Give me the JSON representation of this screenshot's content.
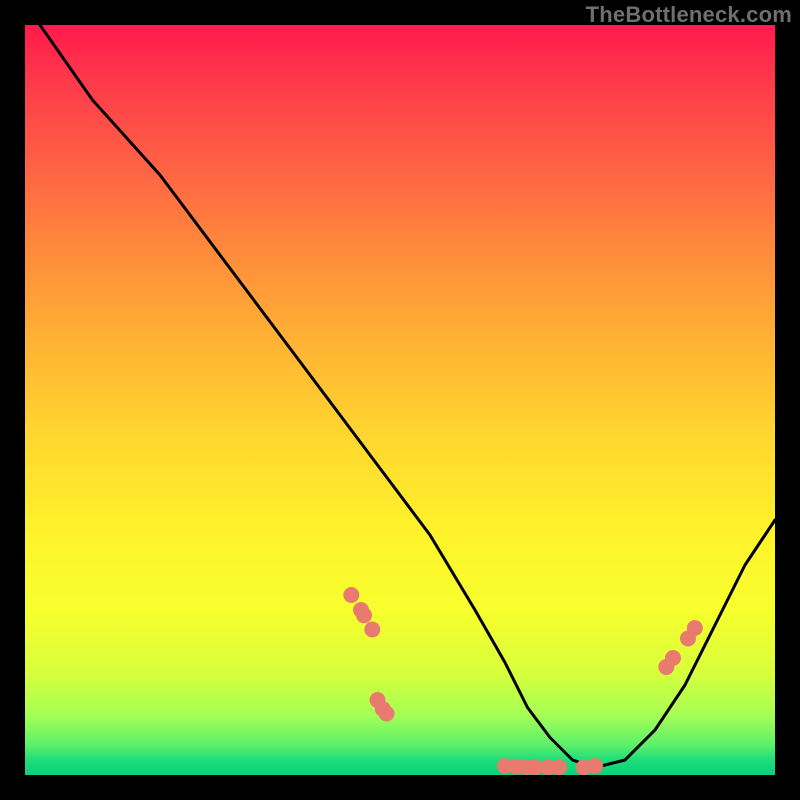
{
  "watermark": "TheBottleneck.com",
  "chart_data": {
    "type": "line",
    "title": "",
    "xlabel": "",
    "ylabel": "",
    "xlim": [
      0,
      100
    ],
    "ylim": [
      0,
      100
    ],
    "series": [
      {
        "name": "curve",
        "x": [
          0,
          2,
          9,
          18,
          27,
          36,
          45,
          54,
          60,
          64,
          67,
          70,
          73,
          76,
          80,
          84,
          88,
          92,
          96,
          100
        ],
        "y": [
          112,
          100,
          90,
          80,
          68,
          56,
          44,
          32,
          22,
          15,
          9,
          5,
          2,
          1,
          2,
          6,
          12,
          20,
          28,
          34
        ]
      }
    ],
    "markers": [
      {
        "x": 43.5,
        "y": 24.0
      },
      {
        "x": 44.8,
        "y": 22.0
      },
      {
        "x": 45.2,
        "y": 21.3
      },
      {
        "x": 46.3,
        "y": 19.4
      },
      {
        "x": 47.0,
        "y": 10.0
      },
      {
        "x": 47.7,
        "y": 8.8
      },
      {
        "x": 48.2,
        "y": 8.2
      },
      {
        "x": 64.0,
        "y": 1.2
      },
      {
        "x": 65.5,
        "y": 1.1
      },
      {
        "x": 66.8,
        "y": 1.0
      },
      {
        "x": 68.0,
        "y": 1.0
      },
      {
        "x": 69.7,
        "y": 1.0
      },
      {
        "x": 71.2,
        "y": 1.0
      },
      {
        "x": 74.5,
        "y": 1.0
      },
      {
        "x": 76.0,
        "y": 1.2
      },
      {
        "x": 85.5,
        "y": 14.4
      },
      {
        "x": 86.4,
        "y": 15.6
      },
      {
        "x": 88.4,
        "y": 18.2
      },
      {
        "x": 89.3,
        "y": 19.6
      }
    ],
    "marker_color": "#e97a6f",
    "marker_radius": 8
  }
}
